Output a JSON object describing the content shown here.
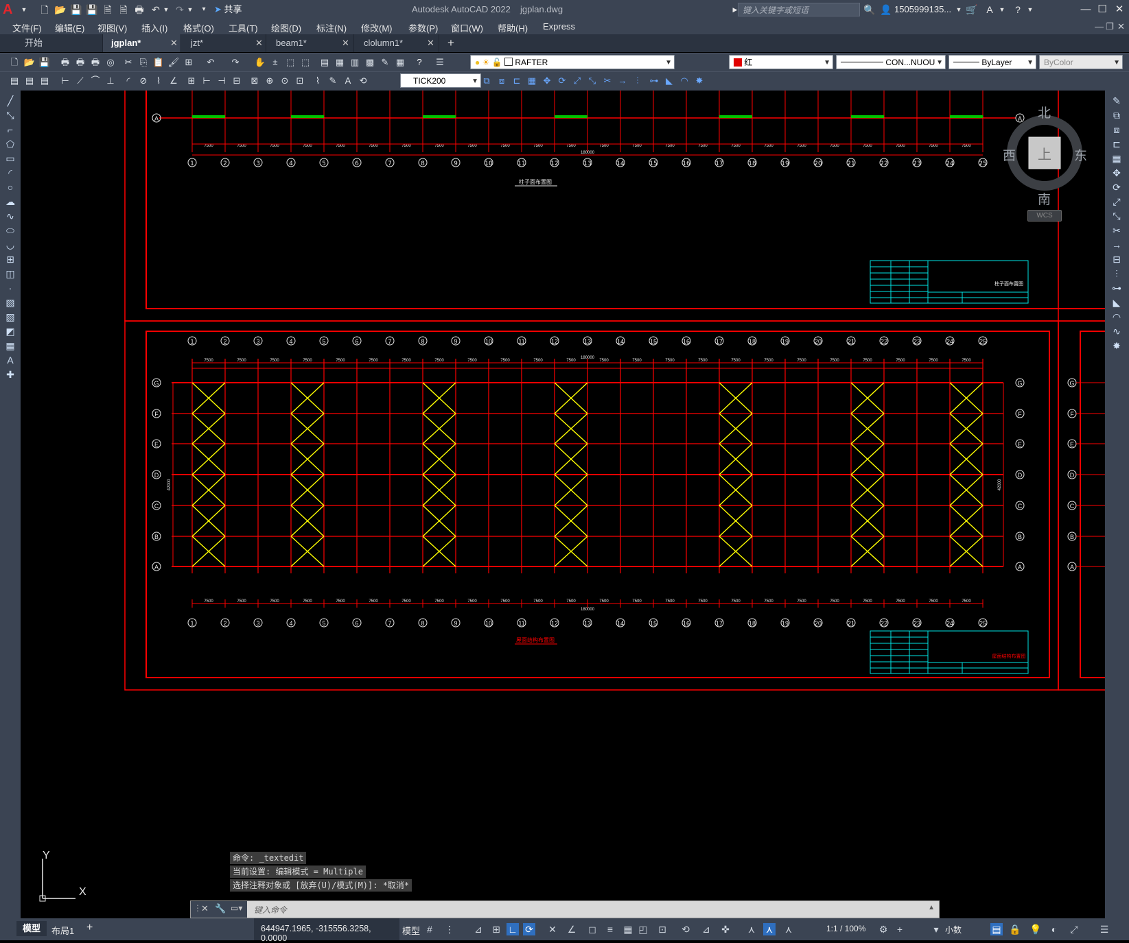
{
  "title_bar": {
    "app_name": "Autodesk AutoCAD 2022",
    "file_name": "jgplan.dwg",
    "share_label": "共享",
    "search_placeholder": "键入关键字或短语",
    "user_name": "1505999135..."
  },
  "menu": [
    "文件(F)",
    "编辑(E)",
    "视图(V)",
    "插入(I)",
    "格式(O)",
    "工具(T)",
    "绘图(D)",
    "标注(N)",
    "修改(M)",
    "参数(P)",
    "窗口(W)",
    "帮助(H)",
    "Express"
  ],
  "tabs": [
    {
      "label": "开始",
      "active": false
    },
    {
      "label": "jgplan*",
      "active": true
    },
    {
      "label": "jzt*",
      "active": false
    },
    {
      "label": "beam1*",
      "active": false
    },
    {
      "label": "clolumn1*",
      "active": false
    }
  ],
  "toolbar": {
    "layer": "RAFTER",
    "color": "红",
    "linetype": "CON...NUOU",
    "lineweight": "ByLayer",
    "plotstyle": "ByColor",
    "dimstyle": "TICK200",
    "accent_red": "#e00000"
  },
  "viewcube": {
    "north": "北",
    "south": "南",
    "west": "西",
    "east": "东",
    "top": "上",
    "wcs": "WCS"
  },
  "ucs": {
    "x": "X",
    "y": "Y"
  },
  "command": {
    "history": [
      "命令: _textedit",
      "当前设置: 编辑模式 = Multiple",
      "选择注释对象或 [放弃(U)/模式(M)]: *取消*"
    ],
    "placeholder": "键入命令"
  },
  "layout_tabs": [
    "模型",
    "布局1"
  ],
  "status": {
    "coordinates": "644947.1965, -315556.3258, 0.0000",
    "model_label": "模型",
    "scale": "1:1 / 100%",
    "units": "小数"
  },
  "drawing": {
    "bay_dimension": "7500",
    "total_length": "180000",
    "total_width": "42000",
    "col_labels": [
      "1",
      "2",
      "3",
      "4",
      "5",
      "6",
      "7",
      "8",
      "9",
      "10",
      "11",
      "12",
      "13",
      "14",
      "15",
      "16",
      "17",
      "18",
      "19",
      "20",
      "21",
      "22",
      "23",
      "24",
      "25"
    ],
    "row_labels": [
      "G",
      "F",
      "E",
      "D",
      "C",
      "B",
      "A"
    ],
    "sheet1_title": "柱子面布置图",
    "sheet2_title": "屋面结构布置图",
    "braced_bays": [
      1,
      4,
      8,
      12,
      17,
      21,
      24
    ]
  }
}
